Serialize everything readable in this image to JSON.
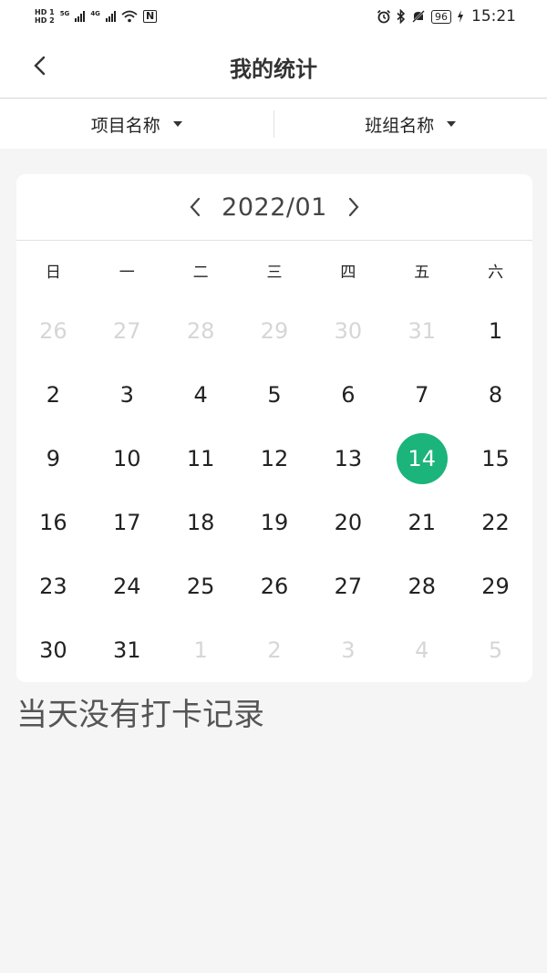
{
  "status_bar": {
    "hd1": "HD 1",
    "hd2": "HD 2",
    "net1": "5G",
    "net2": "4G",
    "nfc": "N",
    "icons": [
      "alarm-icon",
      "bluetooth-icon",
      "mute-icon"
    ],
    "battery": "96",
    "time": "15:21"
  },
  "header": {
    "title": "我的统计"
  },
  "filters": {
    "project": "项目名称",
    "team": "班组名称"
  },
  "calendar": {
    "month_label": "2022/01",
    "weekdays": [
      "日",
      "一",
      "二",
      "三",
      "四",
      "五",
      "六"
    ],
    "days": [
      {
        "label": "26",
        "muted": true
      },
      {
        "label": "27",
        "muted": true
      },
      {
        "label": "28",
        "muted": true
      },
      {
        "label": "29",
        "muted": true
      },
      {
        "label": "30",
        "muted": true
      },
      {
        "label": "31",
        "muted": true
      },
      {
        "label": "1",
        "muted": false
      },
      {
        "label": "2",
        "muted": false
      },
      {
        "label": "3",
        "muted": false
      },
      {
        "label": "4",
        "muted": false
      },
      {
        "label": "5",
        "muted": false
      },
      {
        "label": "6",
        "muted": false
      },
      {
        "label": "7",
        "muted": false
      },
      {
        "label": "8",
        "muted": false
      },
      {
        "label": "9",
        "muted": false
      },
      {
        "label": "10",
        "muted": false
      },
      {
        "label": "11",
        "muted": false
      },
      {
        "label": "12",
        "muted": false
      },
      {
        "label": "13",
        "muted": false
      },
      {
        "label": "14",
        "muted": false,
        "selected": true
      },
      {
        "label": "15",
        "muted": false
      },
      {
        "label": "16",
        "muted": false
      },
      {
        "label": "17",
        "muted": false
      },
      {
        "label": "18",
        "muted": false
      },
      {
        "label": "19",
        "muted": false
      },
      {
        "label": "20",
        "muted": false
      },
      {
        "label": "21",
        "muted": false
      },
      {
        "label": "22",
        "muted": false
      },
      {
        "label": "23",
        "muted": false
      },
      {
        "label": "24",
        "muted": false
      },
      {
        "label": "25",
        "muted": false
      },
      {
        "label": "26",
        "muted": false
      },
      {
        "label": "27",
        "muted": false
      },
      {
        "label": "28",
        "muted": false
      },
      {
        "label": "29",
        "muted": false
      },
      {
        "label": "30",
        "muted": false
      },
      {
        "label": "31",
        "muted": false
      },
      {
        "label": "1",
        "muted": true
      },
      {
        "label": "2",
        "muted": true
      },
      {
        "label": "3",
        "muted": true
      },
      {
        "label": "4",
        "muted": true
      },
      {
        "label": "5",
        "muted": true
      }
    ],
    "selected_color": "#1bb47a"
  },
  "empty_message": "当天没有打卡记录"
}
